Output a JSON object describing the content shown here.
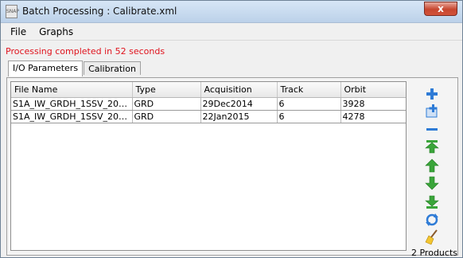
{
  "window": {
    "title": "Batch Processing : Calibrate.xml",
    "close_label": "x"
  },
  "menu": [
    "File",
    "Graphs"
  ],
  "status": "Processing completed in 52 seconds",
  "tabs": [
    "I/O Parameters",
    "Calibration"
  ],
  "table": {
    "columns": [
      "File Name",
      "Type",
      "Acquisition",
      "Track",
      "Orbit"
    ],
    "rows": [
      [
        "S1A_IW_GRDH_1SSV_2014...",
        "GRD",
        "29Dec2014",
        "6",
        "3928"
      ],
      [
        "S1A_IW_GRDH_1SSV_2015...",
        "GRD",
        "22Jan2015",
        "6",
        "4278"
      ]
    ]
  },
  "toolbar": {
    "buttons": [
      "add-icon",
      "add-opened-icon",
      "remove-icon",
      "move-top-icon",
      "move-up-icon",
      "move-down-icon",
      "move-bottom-icon",
      "refresh-icon",
      "clear-icon"
    ],
    "product_count": "2 Products"
  },
  "colors": {
    "status": "#e0141e",
    "icon_blue": "#2e7bd6",
    "icon_green": "#3aa53a"
  }
}
